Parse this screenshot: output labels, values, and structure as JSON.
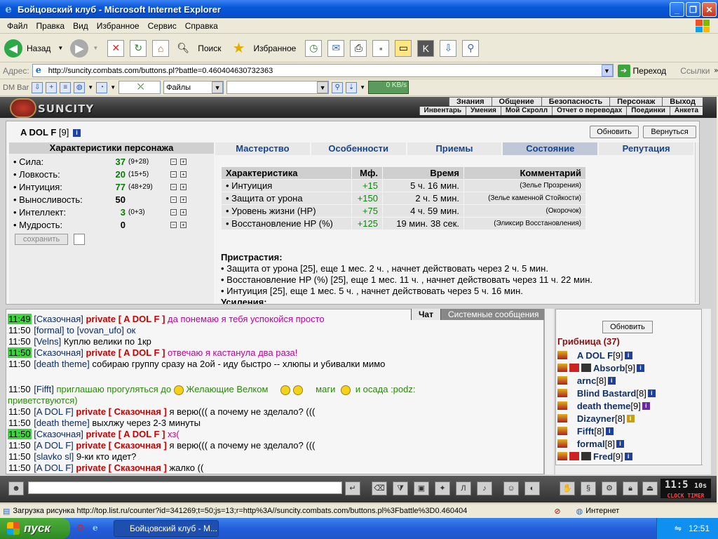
{
  "window": {
    "title": "Бойцовский клуб - Microsoft Internet Explorer"
  },
  "menu": [
    "Файл",
    "Правка",
    "Вид",
    "Избранное",
    "Сервис",
    "Справка"
  ],
  "toolbar": {
    "back": "Назад",
    "search": "Поиск",
    "favorites": "Избранное"
  },
  "address": {
    "label": "Адрес:",
    "url": "http://suncity.combats.com/buttons.pl?battle=0.460404630732363",
    "go": "Переход",
    "links": "Ссылки"
  },
  "dmbar": {
    "label": "DM Bar",
    "files": "Файлы",
    "speed": "0 KB/s"
  },
  "site": {
    "logo": "SUNCITY",
    "nav1": [
      "Знания",
      "Общение",
      "Безопасность",
      "Персонаж",
      "Выход"
    ],
    "nav2": [
      "Инвентарь",
      "Умения",
      "Мой Скролл",
      "Отчет о переводах",
      "Поединки",
      "Анкета"
    ]
  },
  "character": {
    "name": "A DOL F",
    "level": "[9]",
    "refresh": "Обновить",
    "back": "Вернуться",
    "stats_title": "Характеристики персонажа",
    "stats": [
      {
        "name": "Сила:",
        "value": "37",
        "detail": "(9+28)"
      },
      {
        "name": "Ловкость:",
        "value": "20",
        "detail": "(15+5)"
      },
      {
        "name": "Интуиция:",
        "value": "77",
        "detail": "(48+29)"
      },
      {
        "name": "Выносливость:",
        "value": "50",
        "detail": ""
      },
      {
        "name": "Интеллект:",
        "value": "3",
        "detail": "(0+3)"
      },
      {
        "name": "Мудрость:",
        "value": "0",
        "detail": ""
      }
    ],
    "save": "сохранить"
  },
  "tabs": [
    "Мастерство",
    "Особенности",
    "Приемы",
    "Состояние",
    "Репутация"
  ],
  "effects": {
    "headers": [
      "Характеристика",
      "Мф.",
      "Время",
      "Комментарий"
    ],
    "rows": [
      [
        "• Интуиция",
        "+15",
        "5 ч. 16 мин.",
        "(Зелье Прозрения)"
      ],
      [
        "• Защита от урона",
        "+150",
        "2 ч. 5 мин.",
        "(Зелье каменной Стойкости)"
      ],
      [
        "• Уровень жизни (HP)",
        "+75",
        "4 ч. 59 мин.",
        "(Окорочок)"
      ],
      [
        "• Восстановление HP (%)",
        "+125",
        "19 мин. 38 сек.",
        "(Эликсир Восстановления)"
      ]
    ]
  },
  "addictions": {
    "title": "Пристрастия:",
    "items": [
      "• Защита от урона [25], еще 1 мес. 2 ч. , начнет действовать через 2 ч. 5 мин.",
      "• Восстановление HP (%) [25], еще 1 мес. 11 ч. , начнет действовать через 11 ч. 22 мин.",
      "• Интуиция [25], еще 1 мес. 5 ч. , начнет действовать через 5 ч. 16 мин."
    ],
    "boosts": "Усиления:"
  },
  "chat": {
    "tabs": [
      "Чат",
      "Системные сообщения"
    ],
    "lines": [
      {
        "time": "11:49",
        "hl": true,
        "nick": "[Сказочная]",
        "priv": "private [ A DOL F ]",
        "text": "да понемаю я тебя успокойся просто",
        "type": "p"
      },
      {
        "time": "11:50",
        "hl": false,
        "nick": "[formal]",
        "priv": "",
        "text": "to [vovan_ufo] ок",
        "type": "to"
      },
      {
        "time": "11:50",
        "hl": false,
        "nick": "[Velns]",
        "priv": "",
        "text": "Куплю велики по 1кр",
        "type": "n"
      },
      {
        "time": "11:50",
        "hl": true,
        "nick": "[Сказочная]",
        "priv": "private [ A DOL F ]",
        "text": "отвечаю я кастанула два раза!",
        "type": "p"
      },
      {
        "time": "11:50",
        "hl": false,
        "nick": "[death theme]",
        "priv": "",
        "text": "собираю группу сразу на 2ой - иду быстро -- хлюпы и убивалки мимо",
        "type": "n"
      },
      {
        "time": "11:50",
        "hl": false,
        "nick": "[Fifft]",
        "priv": "",
        "text": "приглашаю прогуляться до",
        "type": "g",
        "extra": "Желающие Велком",
        "extra2": "маги",
        "extra3": "и осада :podz:",
        "wrap": "приветствуются)"
      },
      {
        "time": "11:50",
        "hl": false,
        "nick": "[A DOL F]",
        "priv": "private [ Сказочная ]",
        "text": "я верю((( а почему не зделало? (((",
        "type": "n"
      },
      {
        "time": "11:50",
        "hl": false,
        "nick": "[death theme]",
        "priv": "",
        "text": "выхлжу через 2-3 минуты",
        "type": "n"
      },
      {
        "time": "11:50",
        "hl": true,
        "nick": "[Сказочная]",
        "priv": "private [ A DOL F ]",
        "text": "хз(",
        "type": "p"
      },
      {
        "time": "11:50",
        "hl": false,
        "nick": "[A DOL F]",
        "priv": "private [ Сказочная ]",
        "text": "я верю((( а почему не зделало? (((",
        "type": "n"
      },
      {
        "time": "11:50",
        "hl": false,
        "nick": "[slavko sl]",
        "priv": "",
        "text": "9-ки кто идет?",
        "type": "n"
      },
      {
        "time": "11:50",
        "hl": false,
        "nick": "[A DOL F]",
        "priv": "private [ Сказочная ]",
        "text": "жалко ((",
        "type": "n"
      }
    ]
  },
  "users": {
    "refresh": "Обновить",
    "room": "Грибница (37)",
    "list": [
      {
        "name": "A DOL F",
        "level": "[9]"
      },
      {
        "name": "Absorb",
        "level": "[9]"
      },
      {
        "name": "arnc",
        "level": "[8]"
      },
      {
        "name": "Blind Bastard",
        "level": "[8]"
      },
      {
        "name": "death theme",
        "level": "[9]"
      },
      {
        "name": "Dizayner",
        "level": "[8]"
      },
      {
        "name": "Fifft",
        "level": "[8]"
      },
      {
        "name": "formal",
        "level": "[8]"
      },
      {
        "name": "Fred",
        "level": "[9]"
      }
    ]
  },
  "clock": {
    "time": "11:5",
    "secs": "10s",
    "lbl1": "CLOCK",
    "lbl2": "TIMER"
  },
  "status": {
    "text": "Загрузка рисунка http://top.list.ru/counter?id=341269;t=50;js=13;r=http%3A//suncity.combats.com/buttons.pl%3Fbattle%3D0.460404",
    "zone": "Интернет"
  },
  "taskbar": {
    "start": "пуск",
    "item": "Бойцовский клуб - M...",
    "time": "12:51"
  }
}
